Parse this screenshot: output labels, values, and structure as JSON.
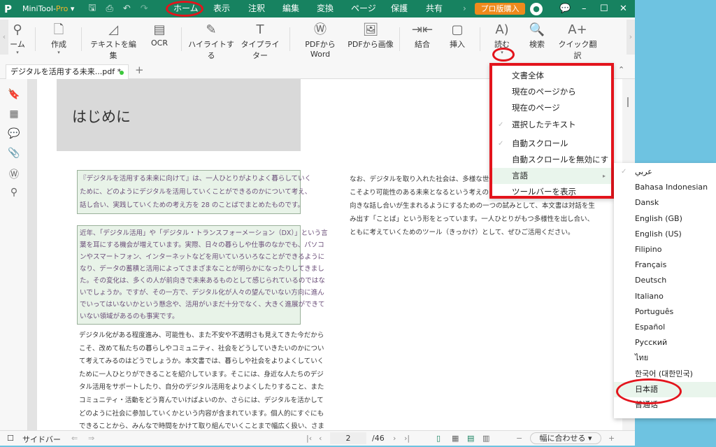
{
  "app": {
    "logo": "P",
    "name": "MiniTool-",
    "name_suffix": "Pro",
    "buy_label": "プロ版購入"
  },
  "menu": [
    "ホーム",
    "表示",
    "注釈",
    "編集",
    "変換",
    "ページ",
    "保護",
    "共有"
  ],
  "toolbar": [
    {
      "label": "ーム",
      "icon": "zoom-icon"
    },
    {
      "label": "作成",
      "icon": "create-file-icon"
    },
    {
      "label": "テキストを編集",
      "icon": "edit-text-icon"
    },
    {
      "label": "OCR",
      "icon": "ocr-icon"
    },
    {
      "label": "ハイライトする",
      "icon": "highlight-icon"
    },
    {
      "label": "タイプライター",
      "icon": "typewriter-icon"
    },
    {
      "label": "PDFからWord",
      "icon": "pdf-to-word-icon"
    },
    {
      "label": "PDFから画像",
      "icon": "pdf-to-image-icon"
    },
    {
      "label": "結合",
      "icon": "merge-icon"
    },
    {
      "label": "挿入",
      "icon": "insert-icon"
    },
    {
      "label": "読む",
      "icon": "read-aloud-icon"
    },
    {
      "label": "検索",
      "icon": "search-icon"
    },
    {
      "label": "クイック翻訳",
      "icon": "translate-icon"
    }
  ],
  "tab": {
    "title": "デジタルを活用する未来...pdf *"
  },
  "document": {
    "heading": "はじめに",
    "block1": [
      "『デジタルを活用する未来に向けて』は、一人ひとりがよりよく暮らしていく",
      "ために、どのようにデジタルを活用していくことができるのかについて考え、",
      "話し合い、実践していくための考え方を 28 のことばでまとめたものです。"
    ],
    "block2": [
      "近年、「デジタル活用」や「デジタル・トランスフォーメーション（DX）」という言",
      "葉を耳にする機会が増えています。実際、日々の暮らしや仕事のなかでも、パソコ",
      "ンやスマートフォン、インターネットなどを用いていろいろなことができるように",
      "なり、データの蓄積と活用によってさまざまなことが明らかになったりしてきまし",
      "た。その変化は、多くの人が前向きで未来あるものとして感じられているのではな",
      "いでしょうか。ですが、その一方で、デジタル化が人々の望んでいない方向に進ん",
      "でいってはいないかという懸念や、活用がいまだ十分でなく、大きく進展ができて",
      "いない領域があるのも事実です。"
    ],
    "block3": [
      "デジタル化がある程度進み、可能性も、また不安や不透明さも見えてきた今だから",
      "こそ、改めて私たちの暮らしやコミュニティ、社会をどうしていきたいのかについ",
      "て考えてみるのはどうでしょうか。本文書では、暮らしや社会をよりよくしていく",
      "ために一人ひとりができることを紹介しています。そこには、身近な人たちのデジ",
      "タル活用をサポートしたり、自分のデジタル活用をよりよくしたりすること、また",
      "コミュニティ・活動をどう育んでいけばよいのか、さらには、デジタルを活かして",
      "どのように社会に参加していくかという内容が含まれています。個人的にすぐにも",
      "できることから、みんなで時間をかけて取り組んでいくことまで幅広く扱い、さま",
      "ざまな人がいろいろなことに取り組むことで、よりよい暮らしや社会に向かってい"
    ],
    "right": [
      "なお、デジタルを取り入れた社会は、多様な世代・",
      "こそより可能性のある未来となるという考えのもと",
      "向きな話し合いが生まれるようにするための一つの試みとして、本文書は対話を生",
      "み出す「ことば」という形をとっています。一人ひとりがもつ多様性を出し合い、",
      "ともに考えていくためのツール（きっかけ）として、ぜひご活用ください。"
    ]
  },
  "read_menu": [
    {
      "label": "文書全体"
    },
    {
      "label": "現在のページから"
    },
    {
      "label": "現在のページ"
    },
    {
      "label": "選択したテキスト",
      "checked": true
    },
    {
      "label": "自動スクロール",
      "checked": true
    },
    {
      "label": "自動スクロールを無効にする"
    },
    {
      "label": "言語",
      "submenu": true,
      "active": true
    },
    {
      "label": "ツールバーを表示"
    }
  ],
  "languages": [
    {
      "label": "عربي",
      "checked": true
    },
    {
      "label": "Bahasa Indonesian"
    },
    {
      "label": "Dansk"
    },
    {
      "label": "English (GB)"
    },
    {
      "label": "English (US)"
    },
    {
      "label": "Filipino"
    },
    {
      "label": "Français"
    },
    {
      "label": "Deutsch"
    },
    {
      "label": "Italiano"
    },
    {
      "label": "Português"
    },
    {
      "label": "Español"
    },
    {
      "label": "Русский"
    },
    {
      "label": "ไทย"
    },
    {
      "label": "한국어 (대한민국)"
    },
    {
      "label": "日本語",
      "active": true
    },
    {
      "label": "普通话"
    }
  ],
  "status": {
    "sidebar_label": "サイドバー",
    "page": "2",
    "total": "/46",
    "zoom": "幅に合わせる"
  },
  "colors": {
    "titlebar": "#178260",
    "buy": "#ef8a1c",
    "annotation": "#e3141c",
    "highlight": "#e8f3e8"
  }
}
